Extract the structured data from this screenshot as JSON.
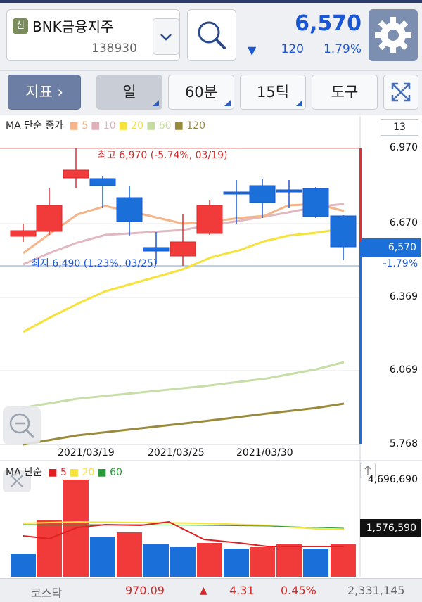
{
  "stock": {
    "badge": "신",
    "name": "BNK금융지주",
    "code": "138930",
    "price": "6,570",
    "change_arrow": "▼",
    "change": "120",
    "change_pct": "1.79%"
  },
  "toolbar": {
    "indicator_label": "지표",
    "period_day": "일",
    "period_60min": "60분",
    "period_15tick": "15틱",
    "tools": "도구"
  },
  "price_chart": {
    "legend_title": "MA 단순 종가",
    "legend": [
      {
        "label": "5",
        "color": "#f5b48a"
      },
      {
        "label": "10",
        "color": "#e0b0b8"
      },
      {
        "label": "20",
        "color": "#f5e23a"
      },
      {
        "label": "60",
        "color": "#c5dca3"
      },
      {
        "label": "120",
        "color": "#9a8a3c"
      }
    ],
    "count": "13",
    "y_labels": [
      "6,970",
      "6,670",
      "6,369",
      "6,069",
      "5,768"
    ],
    "current_price_tag": "6,570",
    "current_change_pct": "-1.79%",
    "high_label": "최고 6,970 (-5.74%, 03/19)",
    "low_label": "최저 6,490 (1.23%, 03/25)",
    "x_labels": [
      "2021/03/19",
      "2021/03/25",
      "2021/03/30"
    ]
  },
  "volume_chart": {
    "legend_title": "MA 단순",
    "legend": [
      {
        "label": "5",
        "color": "#e02020"
      },
      {
        "label": "20",
        "color": "#f5e23a"
      },
      {
        "label": "60",
        "color": "#2a9a3a"
      }
    ],
    "max_label": "4,696,690",
    "current_label": "1,576,590"
  },
  "footer": {
    "market": "코스닥",
    "index": "970.09",
    "arrow": "▲",
    "change": "4.31",
    "change_pct": "0.45%",
    "volume": "2,331,145"
  }
}
